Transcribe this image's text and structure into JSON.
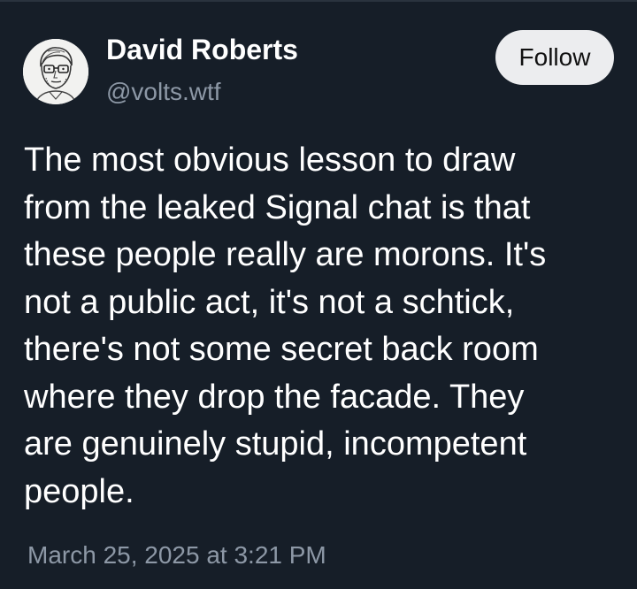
{
  "post": {
    "author": {
      "name": "David Roberts",
      "handle": "@volts.wtf",
      "avatar_icon": "sketched-portrait-avatar"
    },
    "follow_label": "Follow",
    "text_lines": [
      "The most obvious lesson to draw",
      "from the leaked Signal chat is that",
      "these people really are morons. It's",
      "not a public act, it's not a schtick,",
      "there's not some secret back room",
      "where they drop the facade. They",
      "are genuinely stupid, incompetent",
      "people."
    ],
    "timestamp": "March 25, 2025 at 3:21 PM"
  },
  "colors": {
    "background": "#161e28",
    "text": "#ffffff",
    "secondary_text": "#8d98a6",
    "follow_button_bg": "#ecedef"
  }
}
